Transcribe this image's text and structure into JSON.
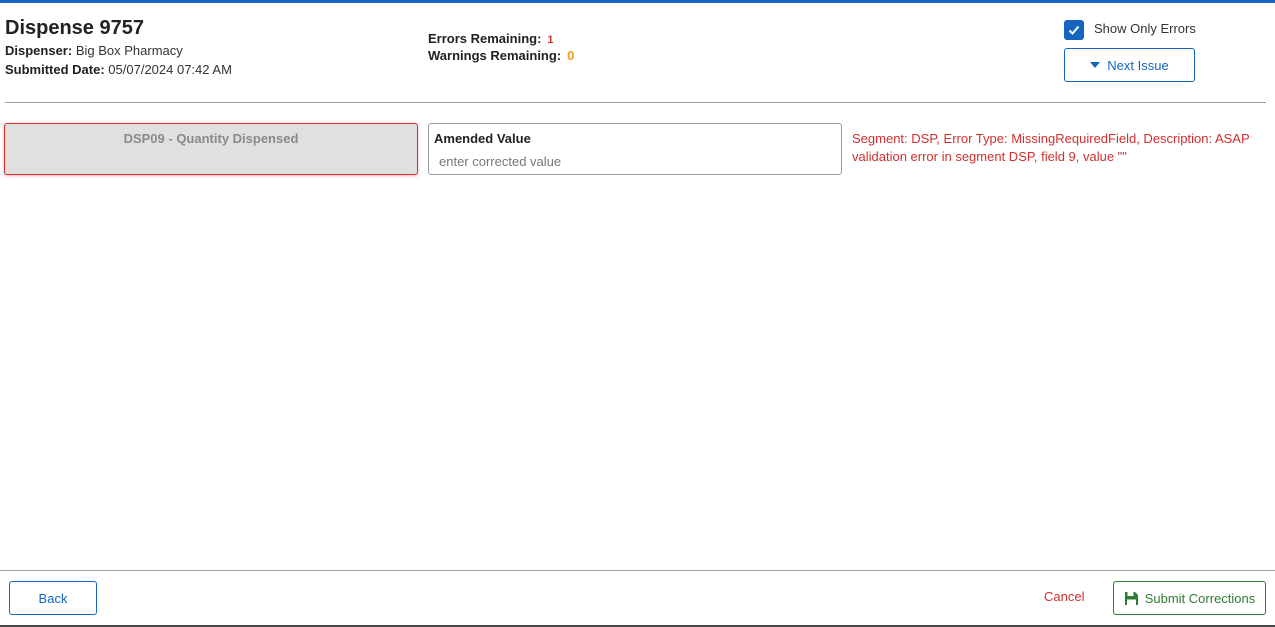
{
  "header": {
    "title": "Dispense 9757",
    "dispenser_label": "Dispenser:",
    "dispenser_value": "Big Box Pharmacy",
    "submitted_label": "Submitted Date:",
    "submitted_value": "05/07/2024 07:42 AM"
  },
  "counts": {
    "errors_label": "Errors Remaining:",
    "errors_value": "1",
    "warnings_label": "Warnings Remaining:",
    "warnings_value": "0"
  },
  "controls": {
    "show_only_errors_label": "Show Only Errors",
    "show_only_errors_checked": true,
    "next_issue_label": "Next Issue"
  },
  "field": {
    "label": "DSP09 - Quantity Dispensed",
    "amended_label": "Amended Value",
    "amended_value": "",
    "amended_placeholder": "enter corrected value",
    "error_message": "Segment: DSP, Error Type: MissingRequiredField, Description: ASAP validation error in segment DSP, field 9, value \"\""
  },
  "footer": {
    "back_label": "Back",
    "cancel_label": "Cancel",
    "submit_label": "Submit Corrections"
  },
  "colors": {
    "accent": "#1565c0",
    "error": "#d32f2f",
    "warning": "#f39c1f",
    "success": "#2e7d32"
  },
  "icons": {
    "checkbox": "check-icon",
    "next_issue": "caret-down-icon",
    "submit": "save-icon"
  }
}
